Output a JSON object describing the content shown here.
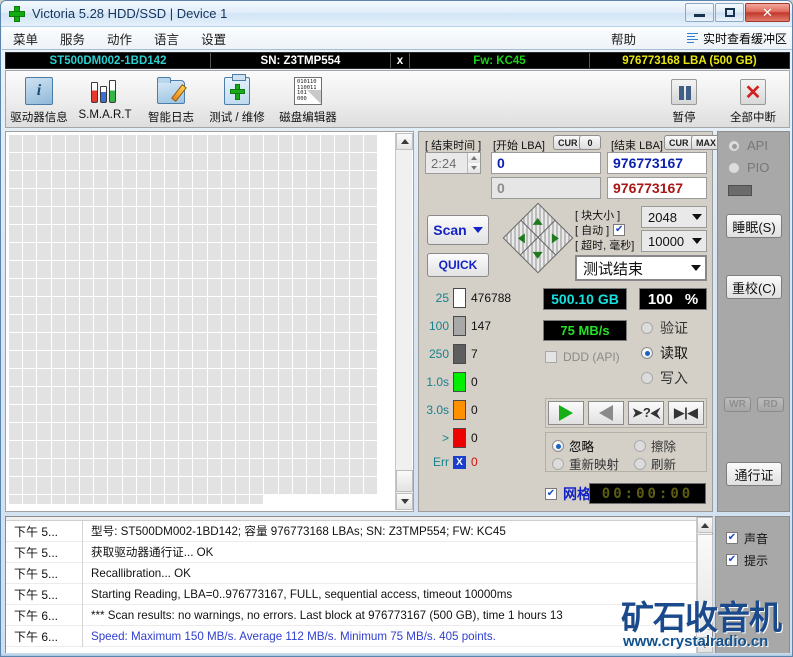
{
  "window": {
    "title": "Victoria 5.28 HDD/SSD | Device 1",
    "icon": "green-cross-icon",
    "minimize": "–",
    "maximize": "□",
    "close": "✕"
  },
  "menubar": {
    "items": [
      "菜单",
      "服务",
      "动作",
      "语言",
      "设置"
    ],
    "help": "帮助",
    "buffer_view": "实时查看缓冲区"
  },
  "device_bar": {
    "model": "ST500DM002-1BD142",
    "serial": "SN: Z3TMP554",
    "x": "x",
    "firmware": "Fw: KC45",
    "capacity": "976773168 LBA (500 GB)"
  },
  "toolbar": {
    "buttons": [
      {
        "label": "驱动器信息",
        "icon": "info-icon"
      },
      {
        "label": "S.M.A.R.T",
        "icon": "smart-icon"
      },
      {
        "label": "智能日志",
        "icon": "log-folder-icon"
      },
      {
        "label": "测试 / 维修",
        "icon": "test-repair-icon"
      },
      {
        "label": "磁盘编辑器",
        "icon": "hex-editor-icon"
      }
    ],
    "pause": {
      "label": "暂停",
      "icon": "pause-icon"
    },
    "abort": {
      "label": "全部中断",
      "icon": "stop-icon"
    }
  },
  "controls": {
    "end_time_label": "[ 结束时间 ]",
    "end_time_value": "2:24",
    "start_lba_label": "[开始 LBA]",
    "start_lba_cur": "CUR",
    "start_lba_zero": "0",
    "start_lba_value": "0",
    "start_lba_second": "0",
    "end_lba_label": "[结束 LBA]",
    "end_lba_cur": "CUR",
    "end_lba_max": "MAX",
    "end_lba_value": "976773167",
    "end_lba_second": "976773167",
    "scan_button": "Scan",
    "quick_button": "QUICK",
    "block_size_label": "[ 块大小 ]",
    "auto_label": "[ 自动 ]",
    "auto_checked": true,
    "block_size_value": "2048",
    "timeout_label": "[ 超时, 毫秒]",
    "timeout_value": "10000",
    "test_end_value": "测试结束"
  },
  "legend": {
    "rows": [
      {
        "threshold": "25",
        "color": "#ffffff",
        "count": "476788"
      },
      {
        "threshold": "100",
        "color": "#a8a8a8",
        "count": "147"
      },
      {
        "threshold": "250",
        "color": "#5e5e5e",
        "count": "7"
      },
      {
        "threshold": "1.0s",
        "color": "#00ee00",
        "count": "0"
      },
      {
        "threshold": "3.0s",
        "color": "#ff9000",
        "count": "0"
      },
      {
        "threshold": ">",
        "color": "#ee0000",
        "count": "0"
      }
    ],
    "error_label": "Err",
    "error_mark": "X",
    "error_count": "0"
  },
  "readouts": {
    "capacity": "500.10 GB",
    "percent": "100",
    "percent_unit": "%",
    "speed": "75 MB/s",
    "ddd_label": "DDD (API)",
    "ddd_checked": false,
    "modes": [
      {
        "label": "验证",
        "selected": false
      },
      {
        "label": "读取",
        "selected": true
      },
      {
        "label": "写入",
        "selected": false
      }
    ],
    "transport": [
      {
        "name": "play-button",
        "glyph": "play"
      },
      {
        "name": "reverse-button",
        "glyph": "reverse"
      },
      {
        "name": "random-button",
        "glyph": "➤?⮜"
      },
      {
        "name": "seek-end-button",
        "glyph": "▶|◀"
      }
    ],
    "defect_actions": [
      {
        "label": "忽略",
        "selected": true
      },
      {
        "label": "擦除",
        "selected": false
      },
      {
        "label": "重新映射",
        "selected": false
      },
      {
        "label": "刷新",
        "selected": false
      }
    ],
    "grid_label": "网格",
    "grid_checked": true,
    "timer": "00:00:00"
  },
  "rightcol": {
    "api_label": "API",
    "api_selected": true,
    "pio_label": "PIO",
    "pio_selected": false,
    "sleep_button": "睡眠(S)",
    "recal_button": "重校(C)",
    "wr_button": "WR",
    "rd_button": "RD",
    "pass_button": "通行证"
  },
  "log": {
    "rows": [
      {
        "time": "下午 5...",
        "message": "型号: ST500DM002-1BD142; 容量 976773168 LBAs; SN: Z3TMP554; FW: KC45",
        "color": "black"
      },
      {
        "time": "下午 5...",
        "message": "获取驱动器通行证... OK",
        "color": "black"
      },
      {
        "time": "下午 5...",
        "message": "Recallibration... OK",
        "color": "black"
      },
      {
        "time": "下午 5...",
        "message": "Starting Reading, LBA=0..976773167, FULL, sequential access, timeout 10000ms",
        "color": "black"
      },
      {
        "time": "下午 6...",
        "message": "*** Scan results: no warnings, no errors. Last block at 976773167 (500 GB), time 1 hours 13",
        "color": "black"
      },
      {
        "time": "下午 6...",
        "message": "Speed: Maximum 150 MB/s. Average 112 MB/s. Minimum 75 MB/s. 405 points.",
        "color": "blue"
      }
    ]
  },
  "log_options": {
    "sound": {
      "label": "声音",
      "checked": true
    },
    "hint": {
      "label": "提示",
      "checked": true
    }
  },
  "watermark": {
    "text": "矿石收音机",
    "url": "www.crystalradio.cn"
  },
  "colors": {
    "accent_blue": "#1423c8",
    "lcd_cyan": "#17e0e0",
    "lcd_green": "#24e024",
    "device_yellow": "#e8e80e",
    "device_green": "#17d417"
  },
  "grid": {
    "columns": 26,
    "rows": 21,
    "filled_cells": 538,
    "cell_color": "#e2e2e2"
  }
}
